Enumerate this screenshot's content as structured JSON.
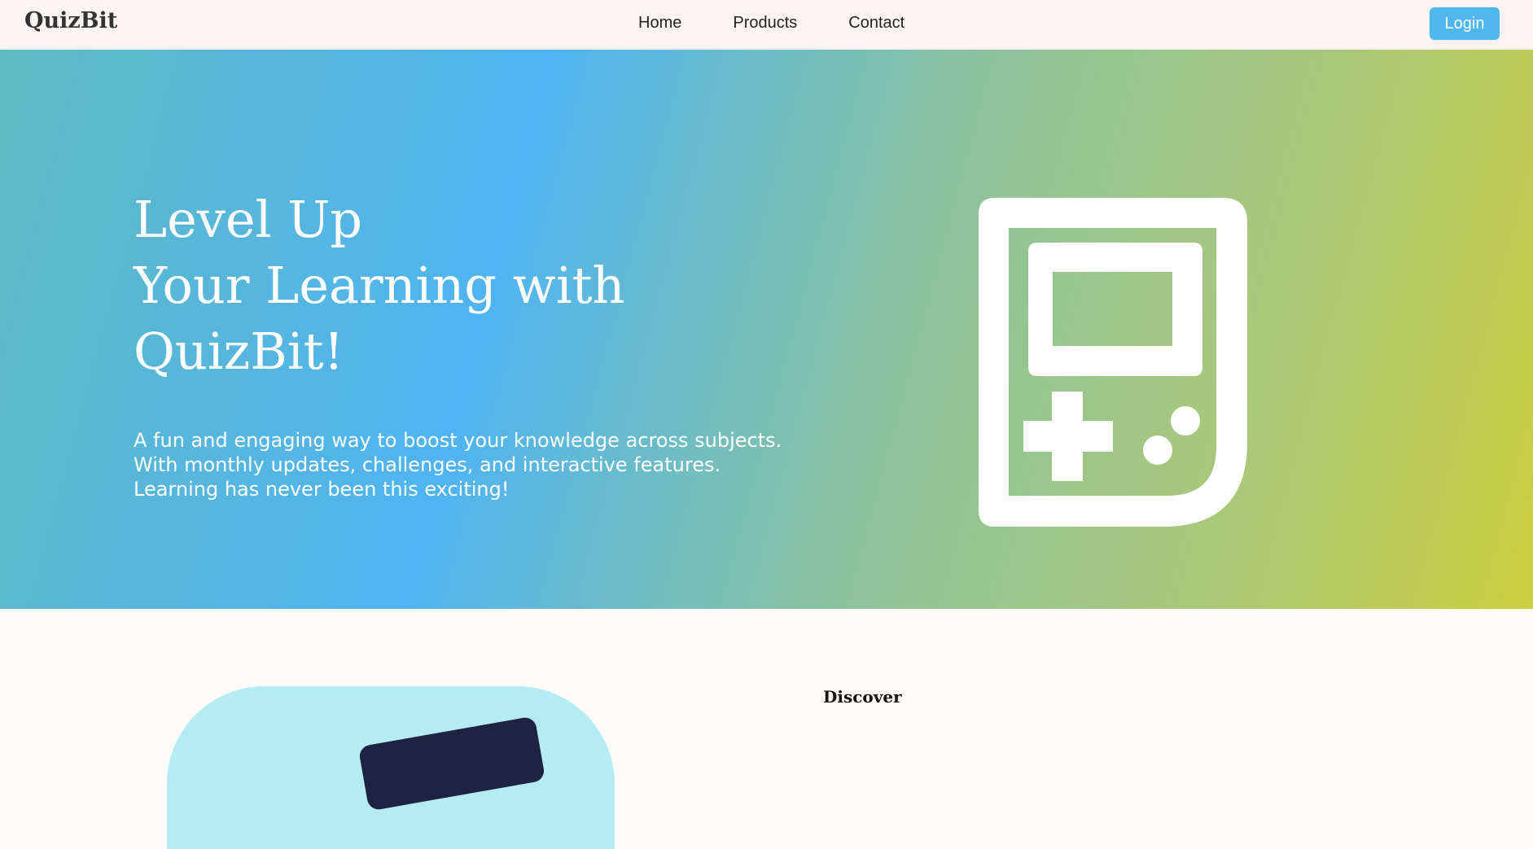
{
  "navbar": {
    "brand": "QuizBit",
    "links": [
      {
        "label": "Home"
      },
      {
        "label": "Products"
      },
      {
        "label": "Contact"
      }
    ],
    "login_label": "Login",
    "background": "#fff4f4",
    "accent": "#4fb6ee"
  },
  "hero": {
    "title_lines": [
      "Level Up",
      "Your Learning with",
      "QuizBit!"
    ],
    "description_lines": [
      "A fun and engaging way to boost your knowledge across subjects.",
      "With monthly updates, challenges, and interactive features.",
      "Learning has never been this exciting!"
    ],
    "icon": "gameboy-icon",
    "gradient_colors": [
      "#5fb9c2",
      "#4fb4f2",
      "#8fc39a",
      "#cccf3e"
    ]
  },
  "discover": {
    "label": "Discover"
  }
}
